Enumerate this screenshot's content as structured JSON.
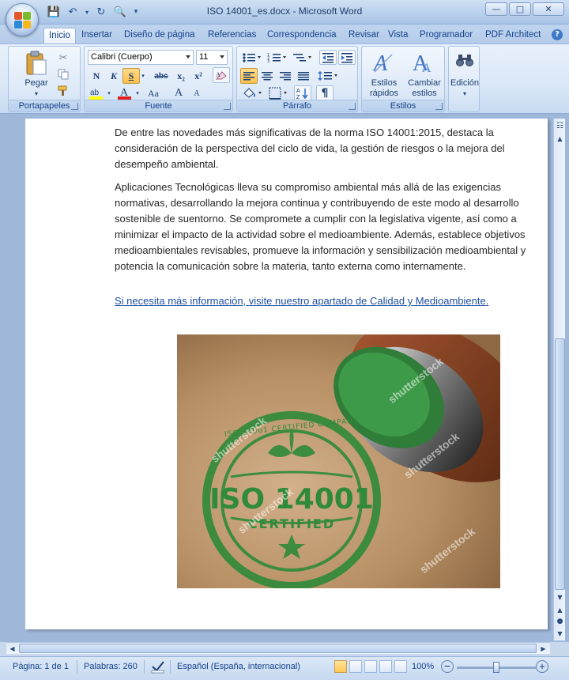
{
  "window": {
    "title": "ISO 14001_es.docx - Microsoft Word"
  },
  "tabs": [
    "Inicio",
    "Insertar",
    "Diseño de página",
    "Referencias",
    "Correspondencia",
    "Revisar",
    "Vista",
    "Programador",
    "PDF Architect"
  ],
  "ribbon": {
    "portapapeles": {
      "label": "Portapapeles",
      "paste_label": "Pegar"
    },
    "fuente": {
      "label": "Fuente",
      "font_name": "Calibri (Cuerpo)",
      "font_size": "11",
      "bold": "N",
      "italic": "K",
      "underline": "S",
      "strike": "abc",
      "sub": "x₂",
      "sup": "x²",
      "change_case": "Aa",
      "grow": "A",
      "shrink": "A"
    },
    "parrafo": {
      "label": "Párrafo"
    },
    "estilos": {
      "label": "Estilos",
      "quick_styles": "Estilos rápidos",
      "change_styles": "Cambiar estilos"
    },
    "edicion": {
      "label": "Edición"
    }
  },
  "document": {
    "paragraph1": "De entre las novedades más significativas de la norma ISO 14001:2015,  destaca la consideración de la perspectiva del ciclo  de vida, la gestión de riesgos o la mejora del desempeño ambiental.",
    "paragraph2": "Aplicaciones Tecnológicas lleva su compromiso ambiental más allá  de las exigencias normativas, desarrollando la mejora continua y contribuyendo de este modo al desarrollo sostenible de suentorno. Se compromete a cumplir con la legislativa vigente, así como a minimizar el impacto de la actividad sobre el medioambiente. Además, establece objetivos medioambientales revisables, promueve la información y sensibilización medioambiental y potencia la comunicación sobre la materia, tanto externa como internamente.",
    "link": "Si necesita más información, visite nuestro apartado de Calidad y Medioambiente.",
    "image": {
      "stamp_top": "ISO 14001 CERTIFIED COMPANY",
      "stamp_main": "ISO 14001",
      "stamp_sub": "CERTIFIED",
      "watermark": "shutterstock"
    }
  },
  "status": {
    "page": "Página: 1 de 1",
    "words": "Palabras: 260",
    "language": "Español (España, internacional)",
    "zoom": "100%",
    "zoom_percent": 100
  },
  "colors": {
    "accent": "#15428b",
    "stamp_green": "#2f8a3a",
    "link": "#1c4fa3"
  }
}
